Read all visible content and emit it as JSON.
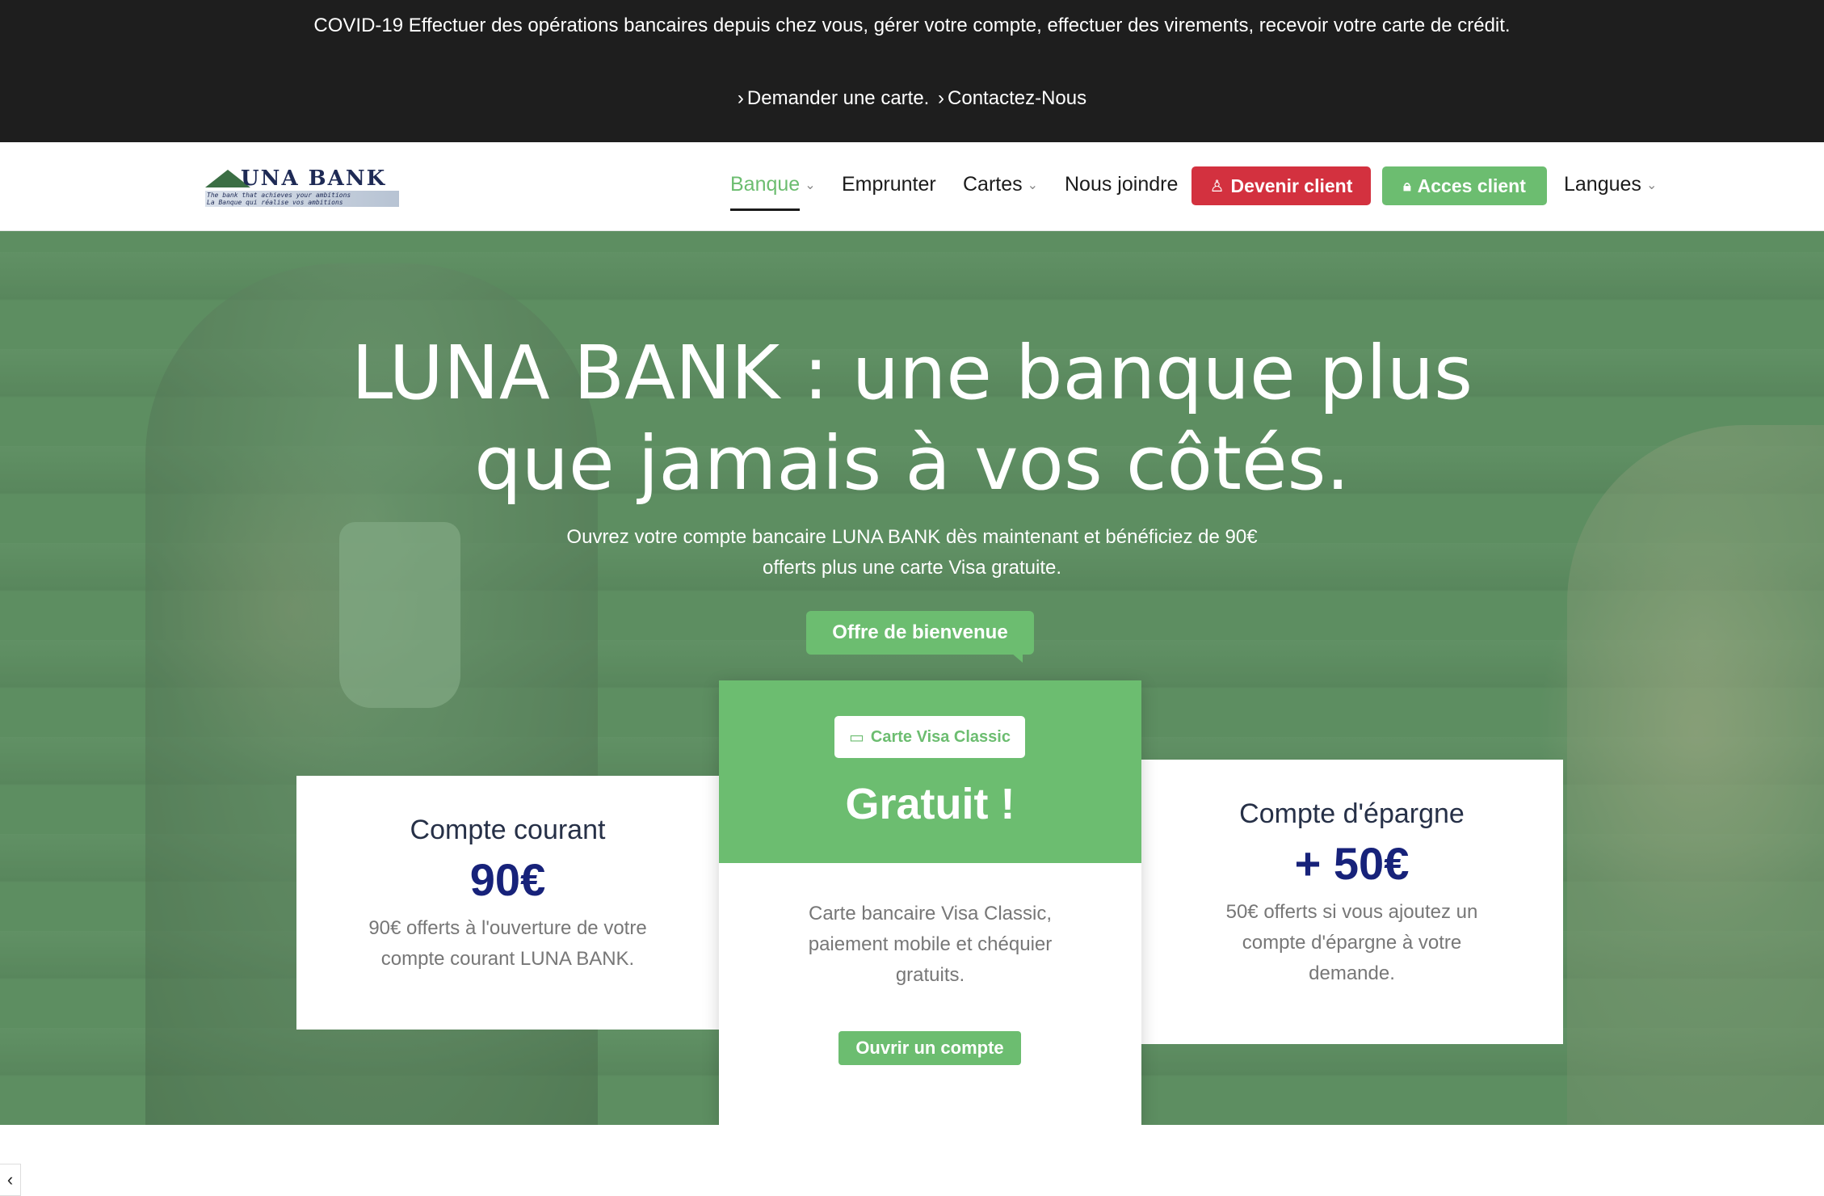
{
  "topbar": {
    "notice_prefix": "COVID-19",
    "notice": "Effectuer des opérations bancaires depuis chez vous, gérer votre compte, effectuer des virements, recevoir votre carte de crédit.",
    "link1": "Demander une carte.",
    "link2": "Contactez-Nous",
    "chevron_icon": "chevron-right-icon"
  },
  "header": {
    "logo": {
      "brand": "UNA BANK",
      "tagline_en": "The bank that achieves your ambitions",
      "tagline_fr": "La Banque qui réalise vos ambitions"
    },
    "nav": {
      "banque": "Banque",
      "emprunter": "Emprunter",
      "cartes": "Cartes",
      "nous_joindre": "Nous joindre",
      "langues": "Langues"
    },
    "devenir_client": "Devenir client",
    "acces_client": "Acces client"
  },
  "hero": {
    "title_line1": "LUNA BANK : une banque plus",
    "title_line2": "que jamais à vos côtés.",
    "subtitle_line1": "Ouvrez votre compte bancaire LUNA BANK dès maintenant et bénéficiez de 90€",
    "subtitle_line2": "offerts plus une carte Visa gratuite.",
    "badge": "Offre de bienvenue"
  },
  "cards": {
    "left": {
      "title": "Compte courant",
      "amount": "90€",
      "desc_line1": "90€ offerts à l'ouverture de votre",
      "desc_line2": "compte courant LUNA BANK."
    },
    "middle": {
      "pill": "Carte Visa Classic",
      "headline": "Gratuit !",
      "desc_line1": "Carte bancaire Visa Classic,",
      "desc_line2": "paiement mobile et chéquier",
      "desc_line3": "gratuits.",
      "button": "Ouvrir un compte"
    },
    "right": {
      "title": "Compte d'épargne",
      "amount": "+ 50€",
      "desc_line1": "50€ offerts si vous ajoutez un",
      "desc_line2": "compte d'épargne à votre",
      "desc_line3": "demande."
    }
  },
  "colors": {
    "green": "#6cbd70",
    "red": "#d3313f",
    "navy": "#17227a",
    "dark": "#1e1e1e"
  }
}
